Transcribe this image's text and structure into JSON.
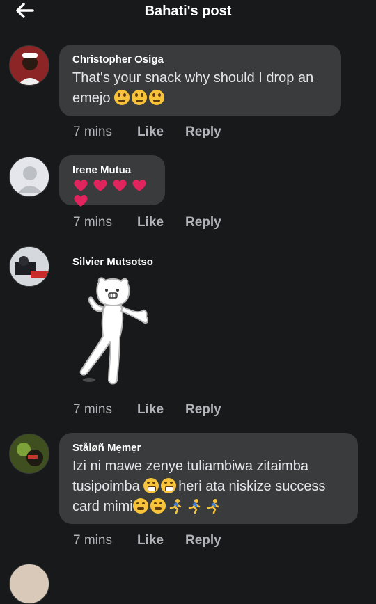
{
  "header": {
    "title": "Bahati's post",
    "back_icon": "arrow-left-icon"
  },
  "comments": [
    {
      "author": "Christopher Osiga",
      "text": "That's your snack why should I drop an emejo",
      "emojis": [
        "rolling-eyes",
        "rolling-eyes",
        "rolling-eyes"
      ],
      "time": "7 mins",
      "like": "Like",
      "reply": "Reply"
    },
    {
      "author": "Irene Mutua",
      "emojis": [
        "heart",
        "heart",
        "heart",
        "heart",
        "heart"
      ],
      "time": "7 mins",
      "like": "Like",
      "reply": "Reply"
    },
    {
      "author": "Silvier Mutsotso",
      "sticker": "dancing-bear-sticker",
      "time": "7 mins",
      "like": "Like",
      "reply": "Reply"
    },
    {
      "author": "Ståløñ Mẹmẹr",
      "text_line1": "Izi ni mawe zenye tuliambiwa zitaimba",
      "text_part2a": "tusipoimba",
      "text_part2b": "heri ata niskize success",
      "text_part3": "card mimi",
      "emojis_a": [
        "beaming-face",
        "beaming-face"
      ],
      "emojis_b": [
        "tears-of-joy",
        "tears-of-joy",
        "runner",
        "runner",
        "runner"
      ],
      "time": "7 mins",
      "like": "Like",
      "reply": "Reply"
    }
  ],
  "colors": {
    "background": "#18191a",
    "bubble": "#3a3b3c",
    "muted": "#b0b3b8",
    "heart": "#e0245e"
  }
}
